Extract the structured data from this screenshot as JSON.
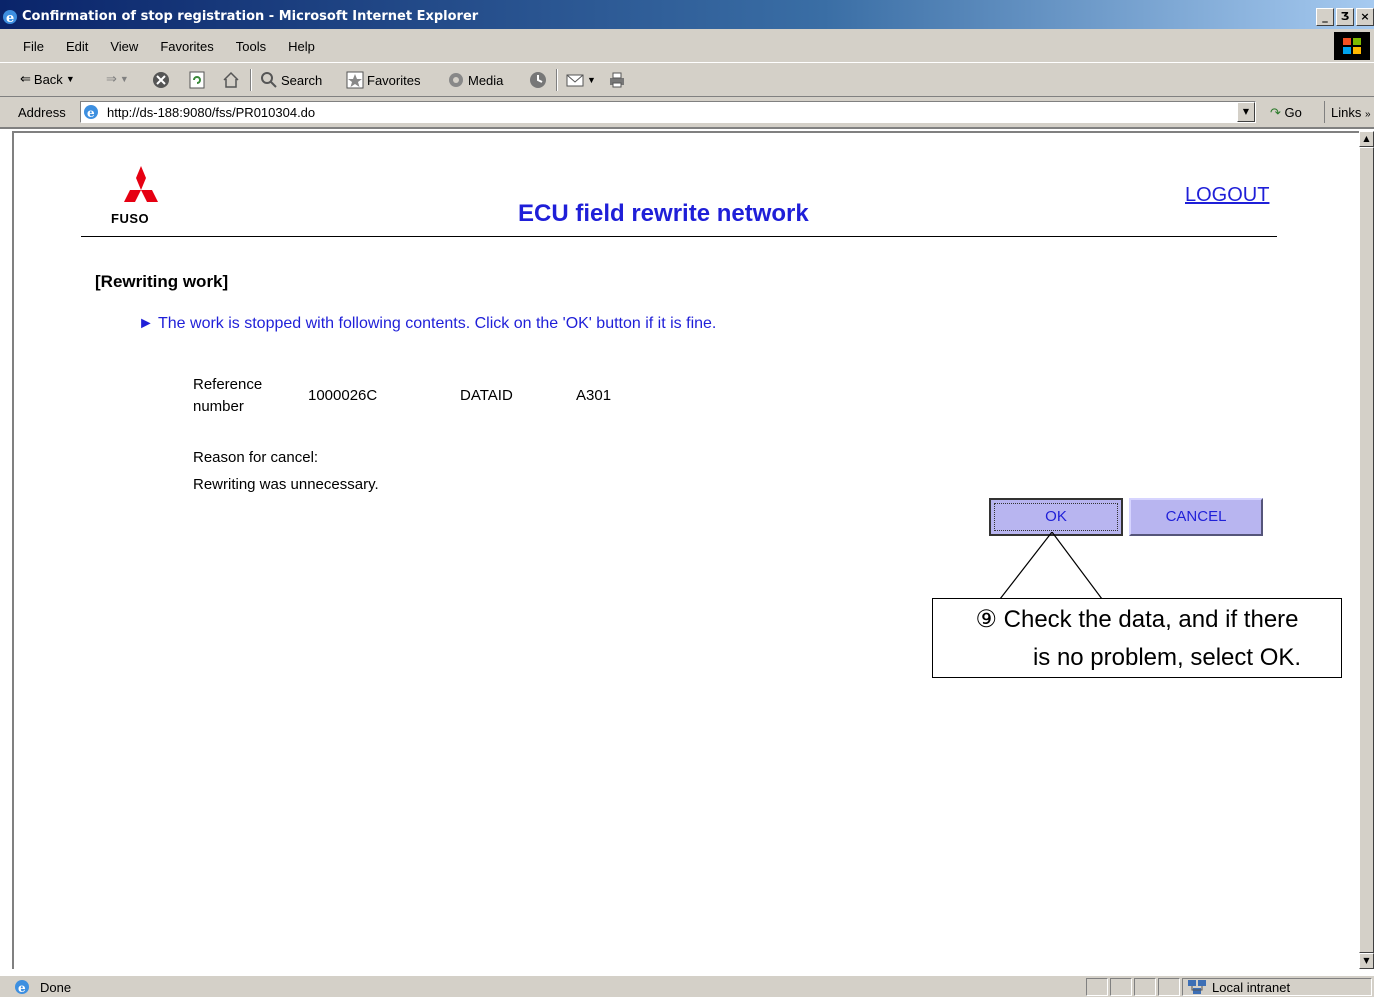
{
  "window": {
    "title": "Confirmation of stop registration - Microsoft Internet Explorer",
    "caption_buttons": [
      "_",
      "Ʒ",
      "×"
    ]
  },
  "menu": {
    "items": [
      "File",
      "Edit",
      "View",
      "Favorites",
      "Tools",
      "Help"
    ]
  },
  "toolbar": {
    "back": "Back",
    "search": "Search",
    "favorites": "Favorites",
    "media": "Media"
  },
  "address": {
    "label": "Address",
    "url": "http://ds-188:9080/fss/PR010304.do",
    "go": "Go",
    "links": "Links"
  },
  "page": {
    "logo_text": "FUSO",
    "header": "ECU field rewrite network",
    "logout": "LOGOUT",
    "section_title": "[Rewriting work]",
    "instruction": "► The work is stopped with following contents. Click on the 'OK' button if it is fine.",
    "info": {
      "reference_label_line1": "Reference",
      "reference_label_line2": "number",
      "reference_value": "1000026C",
      "dataid_label": "DATAID",
      "dataid_value": "A301",
      "reason_label": "Reason for cancel:",
      "reason_value": "Rewriting was unnecessary."
    },
    "buttons": {
      "ok": "OK",
      "cancel": "CANCEL"
    },
    "callout": {
      "line1": "⑨ Check the data, and if there",
      "line2": "is no problem, select OK."
    }
  },
  "status": {
    "text": "Done",
    "zone": "Local intranet"
  },
  "colors": {
    "accent_blue": "#1f1fd8",
    "button_fill": "#b8b5f0",
    "logo_red": "#e60012"
  }
}
